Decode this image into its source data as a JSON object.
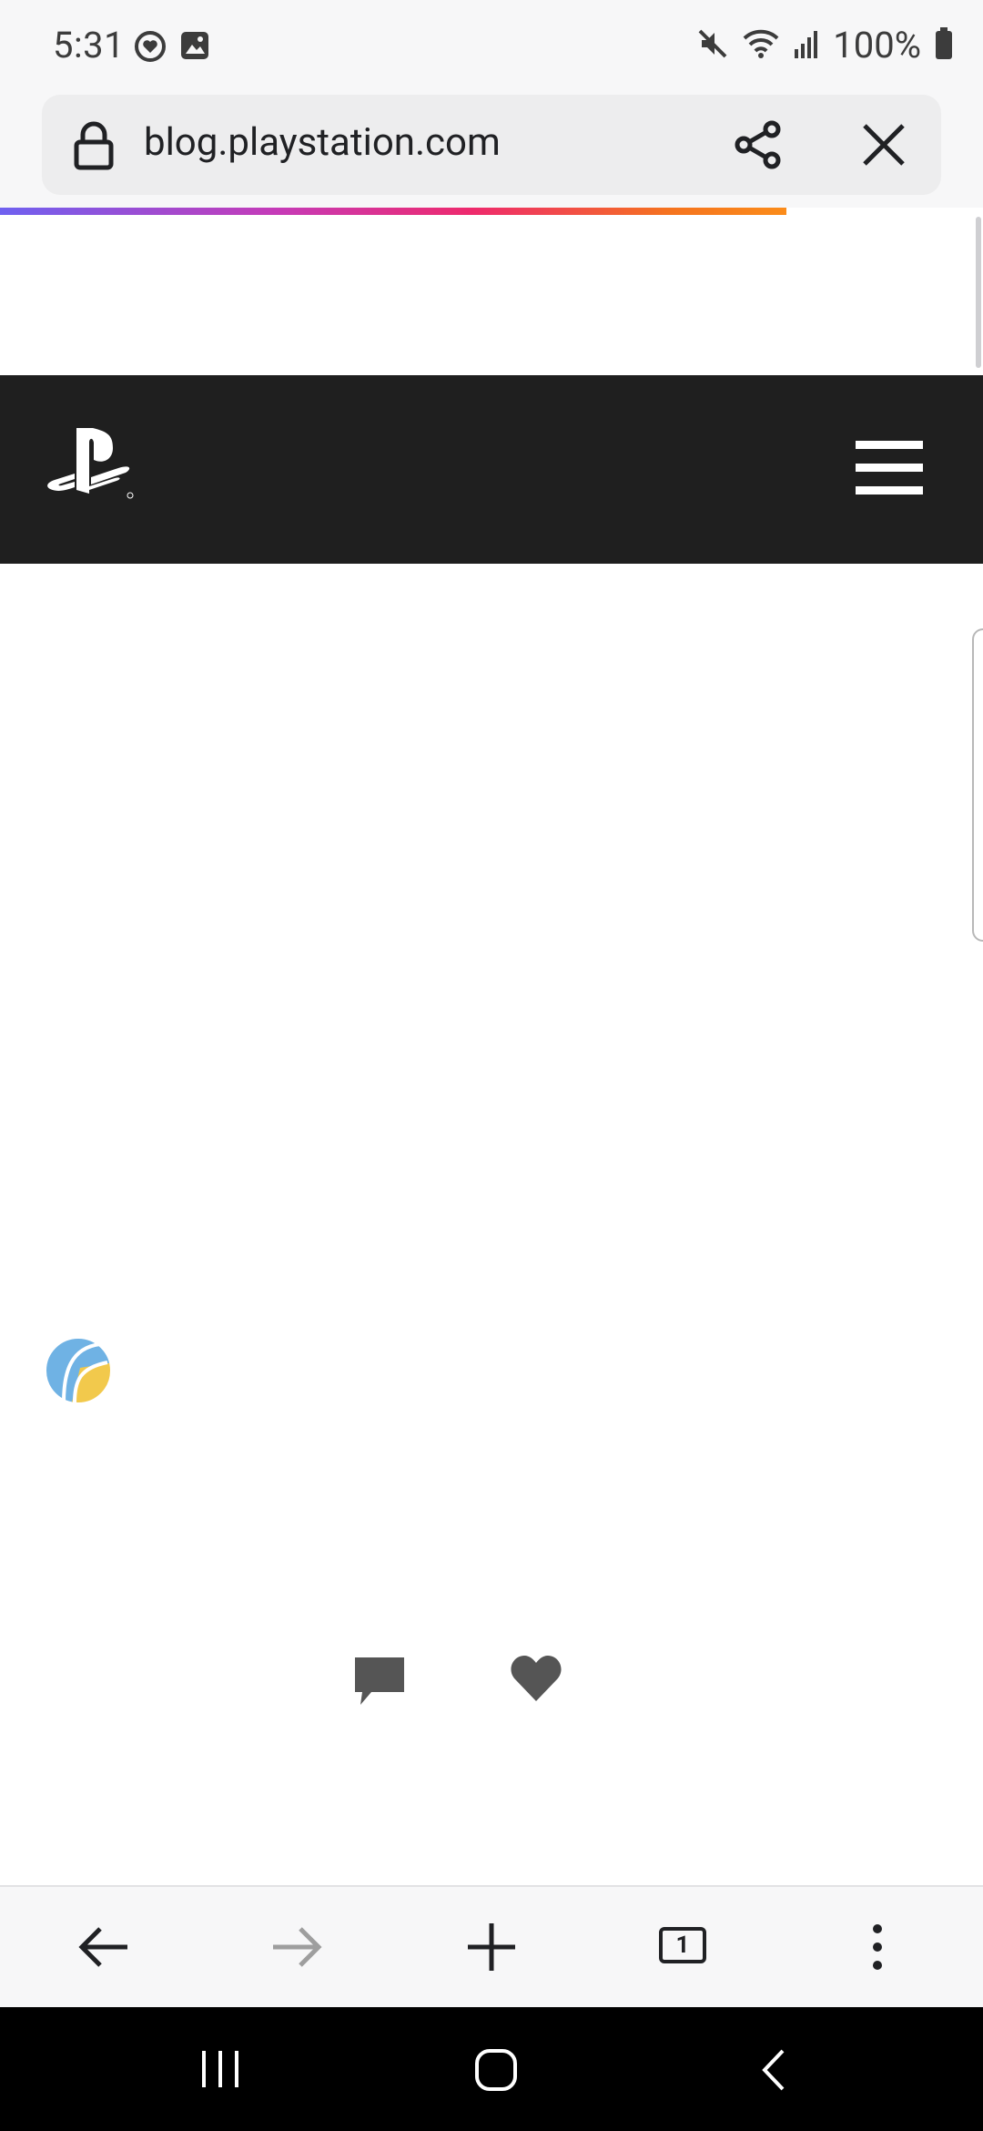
{
  "status_bar": {
    "time": "5:31",
    "battery": "100%",
    "icons": [
      "health-icon",
      "gallery-icon",
      "mute-icon",
      "wifi-icon",
      "signal-icon",
      "battery-icon"
    ]
  },
  "browser": {
    "url": "blog.playstation.com",
    "page_load_progress": 0.8,
    "tab_count": "1",
    "icons": [
      "lock-icon",
      "share-icon",
      "close-icon",
      "back-icon",
      "forward-icon",
      "new-tab-icon",
      "tabs-icon",
      "more-icon"
    ]
  },
  "site": {
    "header_color": "#1f1f1f",
    "icons": [
      "playstation-logo-icon",
      "menu-icon",
      "author-avatar",
      "comment-icon",
      "heart-icon"
    ]
  },
  "system_nav": {
    "icons": [
      "recents-icon",
      "home-icon",
      "back-icon"
    ]
  },
  "colors": {
    "progress_gradient": [
      "#6f61f0",
      "#c53bb8",
      "#ee2a6d",
      "#f5731f"
    ],
    "chrome_bg": "#f7f7f8",
    "url_field_bg": "#ededee"
  }
}
